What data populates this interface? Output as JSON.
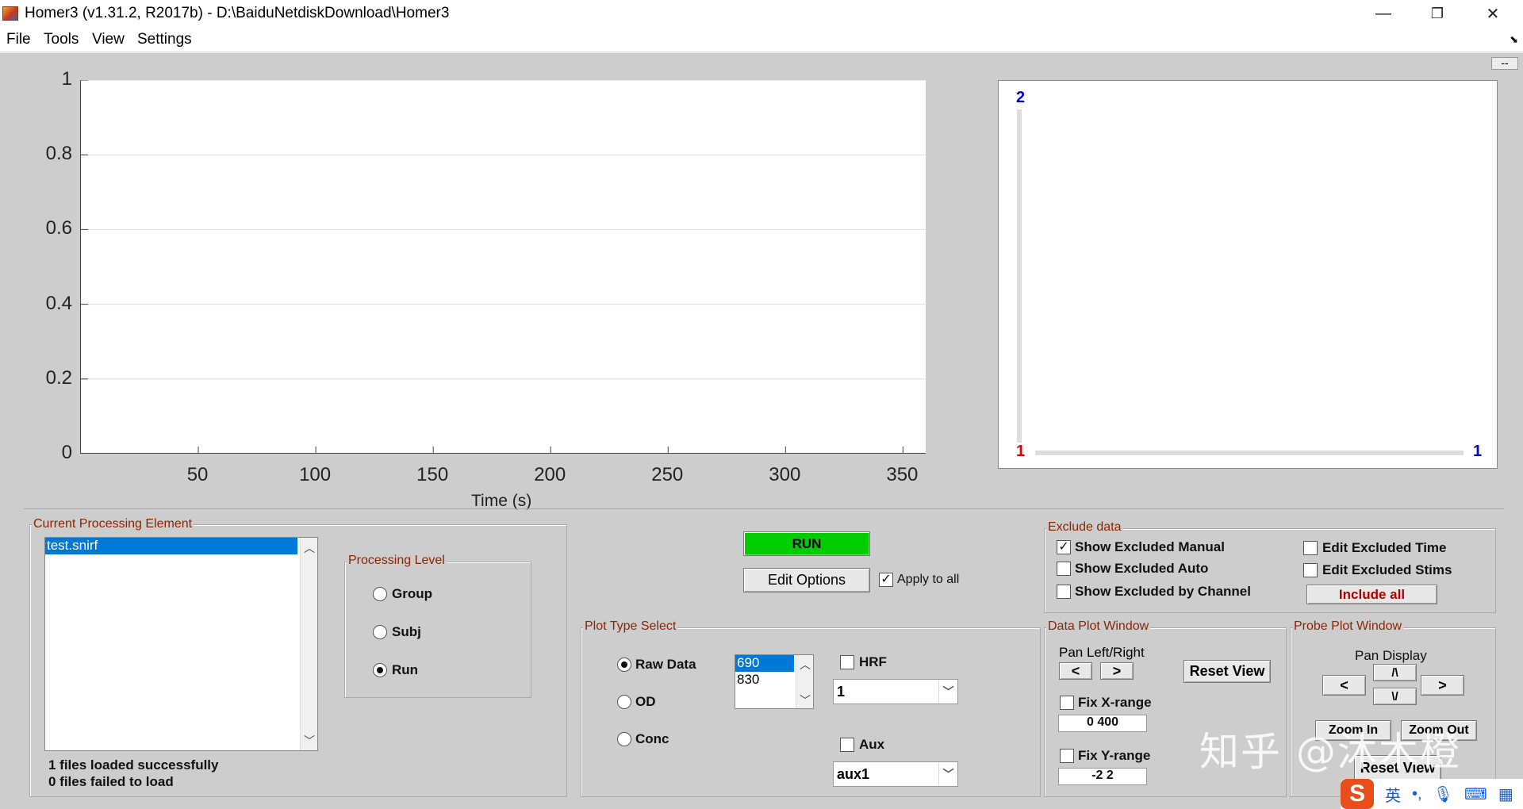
{
  "window": {
    "title": "Homer3 (v1.31.2, R2017b) - D:\\BaiduNetdiskDownload\\Homer3",
    "minimize": "—",
    "restore": "❐",
    "close": "✕"
  },
  "menu": [
    "File",
    "Tools",
    "View",
    "Settings"
  ],
  "menu_arrow": "⬊",
  "minus_button": "--",
  "chart_data": {
    "type": "line",
    "title": "",
    "xlabel": "Time (s)",
    "ylabel": "",
    "xlim": [
      0,
      360
    ],
    "ylim": [
      0,
      1
    ],
    "xticks": [
      50,
      100,
      150,
      200,
      250,
      300,
      350
    ],
    "yticks": [
      0,
      0.2,
      0.4,
      0.6,
      0.8,
      1
    ],
    "ytick_labels": [
      "0",
      "0.2",
      "0.4",
      "0.6",
      "0.8",
      "1"
    ],
    "grid": true,
    "series": []
  },
  "probe": {
    "y_top_label": "2",
    "origin_label": "1",
    "x_right_label": "1",
    "top_color": "#0000cc",
    "origin_color": "#e00000"
  },
  "current_processing": {
    "title": "Current Processing Element",
    "files": [
      "test.snirf"
    ],
    "status_loaded": "1 files loaded successfully",
    "status_failed": "0 files failed to load"
  },
  "processing_level": {
    "title": "Processing Level",
    "options": [
      "Group",
      "Subj",
      "Run"
    ],
    "selected": "Run"
  },
  "run": {
    "run_label": "RUN",
    "run_color": "#00cc00",
    "edit_options_label": "Edit Options",
    "apply_to_all_label": "Apply to all",
    "apply_to_all_checked": true
  },
  "plot_type": {
    "title": "Plot Type Select",
    "options": [
      "Raw Data",
      "OD",
      "Conc"
    ],
    "selected": "Raw Data",
    "wavelengths": [
      "690",
      "830"
    ],
    "hrf_label": "HRF",
    "hrf_value": "1",
    "aux_label": "Aux",
    "aux_value": "aux1"
  },
  "exclude": {
    "title": "Exclude data",
    "show_manual": "Show Excluded Manual",
    "show_auto": "Show Excluded Auto",
    "show_by_channel": "Show Excluded by Channel",
    "edit_time": "Edit Excluded Time",
    "edit_stims": "Edit Excluded Stims",
    "include_all": "Include all",
    "include_color": "#b00000"
  },
  "data_plot_window": {
    "title": "Data Plot Window",
    "pan_label": "Pan Left/Right",
    "left": "<",
    "right": ">",
    "reset_view": "Reset View",
    "fix_x": "Fix X-range",
    "x_range": "0 400",
    "fix_y": "Fix Y-range",
    "y_range": "-2 2"
  },
  "probe_plot_window": {
    "title": "Probe Plot Window",
    "pan_display": "Pan Display",
    "up": "/\\",
    "down": "\\/",
    "left": "<",
    "right": ">",
    "zoom_in": "Zoom In",
    "zoom_out": "Zoom Out",
    "reset_view": "Reset View"
  },
  "watermark": "知乎 @沐木橙",
  "ime": {
    "logo": "S",
    "lang": "英",
    "punct": "•,"
  }
}
